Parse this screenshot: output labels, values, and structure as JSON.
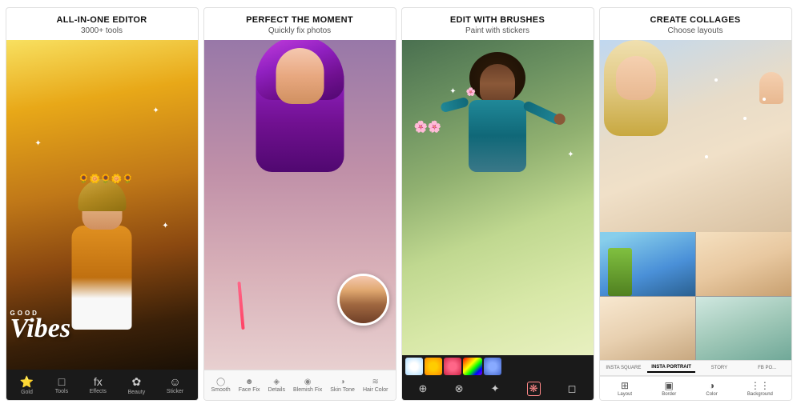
{
  "panels": [
    {
      "id": "panel1",
      "title": "ALL-IN-ONE EDITOR",
      "subtitle": "3000+ tools",
      "toolbar_items": [
        "Gold",
        "Tools",
        "Effects",
        "Beauty",
        "Sticker",
        "..."
      ]
    },
    {
      "id": "panel2",
      "title": "PERFECT THE MOMENT",
      "subtitle": "Quickly fix photos",
      "toolbar_items": [
        "Smooth",
        "Face Fix",
        "Details",
        "Blemish Fix",
        "Skin Tone",
        "Hair Color"
      ]
    },
    {
      "id": "panel3",
      "title": "EDIT WITH BRUSHES",
      "subtitle": "Paint with stickers",
      "toolbar_items": [
        "brush1",
        "brush2",
        "brush3",
        "sticker-tool",
        "erase"
      ]
    },
    {
      "id": "panel4",
      "title": "CREATE COLLAGES",
      "subtitle": "Choose layouts",
      "tabs": [
        "INSTA SQUARE",
        "INSTA PORTRAIT",
        "STORY",
        "FB PO..."
      ],
      "active_tab": "INSTA PORTRAIT",
      "toolbar_items": [
        "Layout",
        "Border",
        "Color",
        "Background"
      ]
    }
  ],
  "vibes_text": {
    "good": "GOOD",
    "vibes": "Vibes"
  },
  "colors": {
    "toolbar_dark": "#1a1a1a",
    "toolbar_light": "#f8f8f8",
    "active_tab": "#000000",
    "panel_border": "#e0e0e0"
  }
}
